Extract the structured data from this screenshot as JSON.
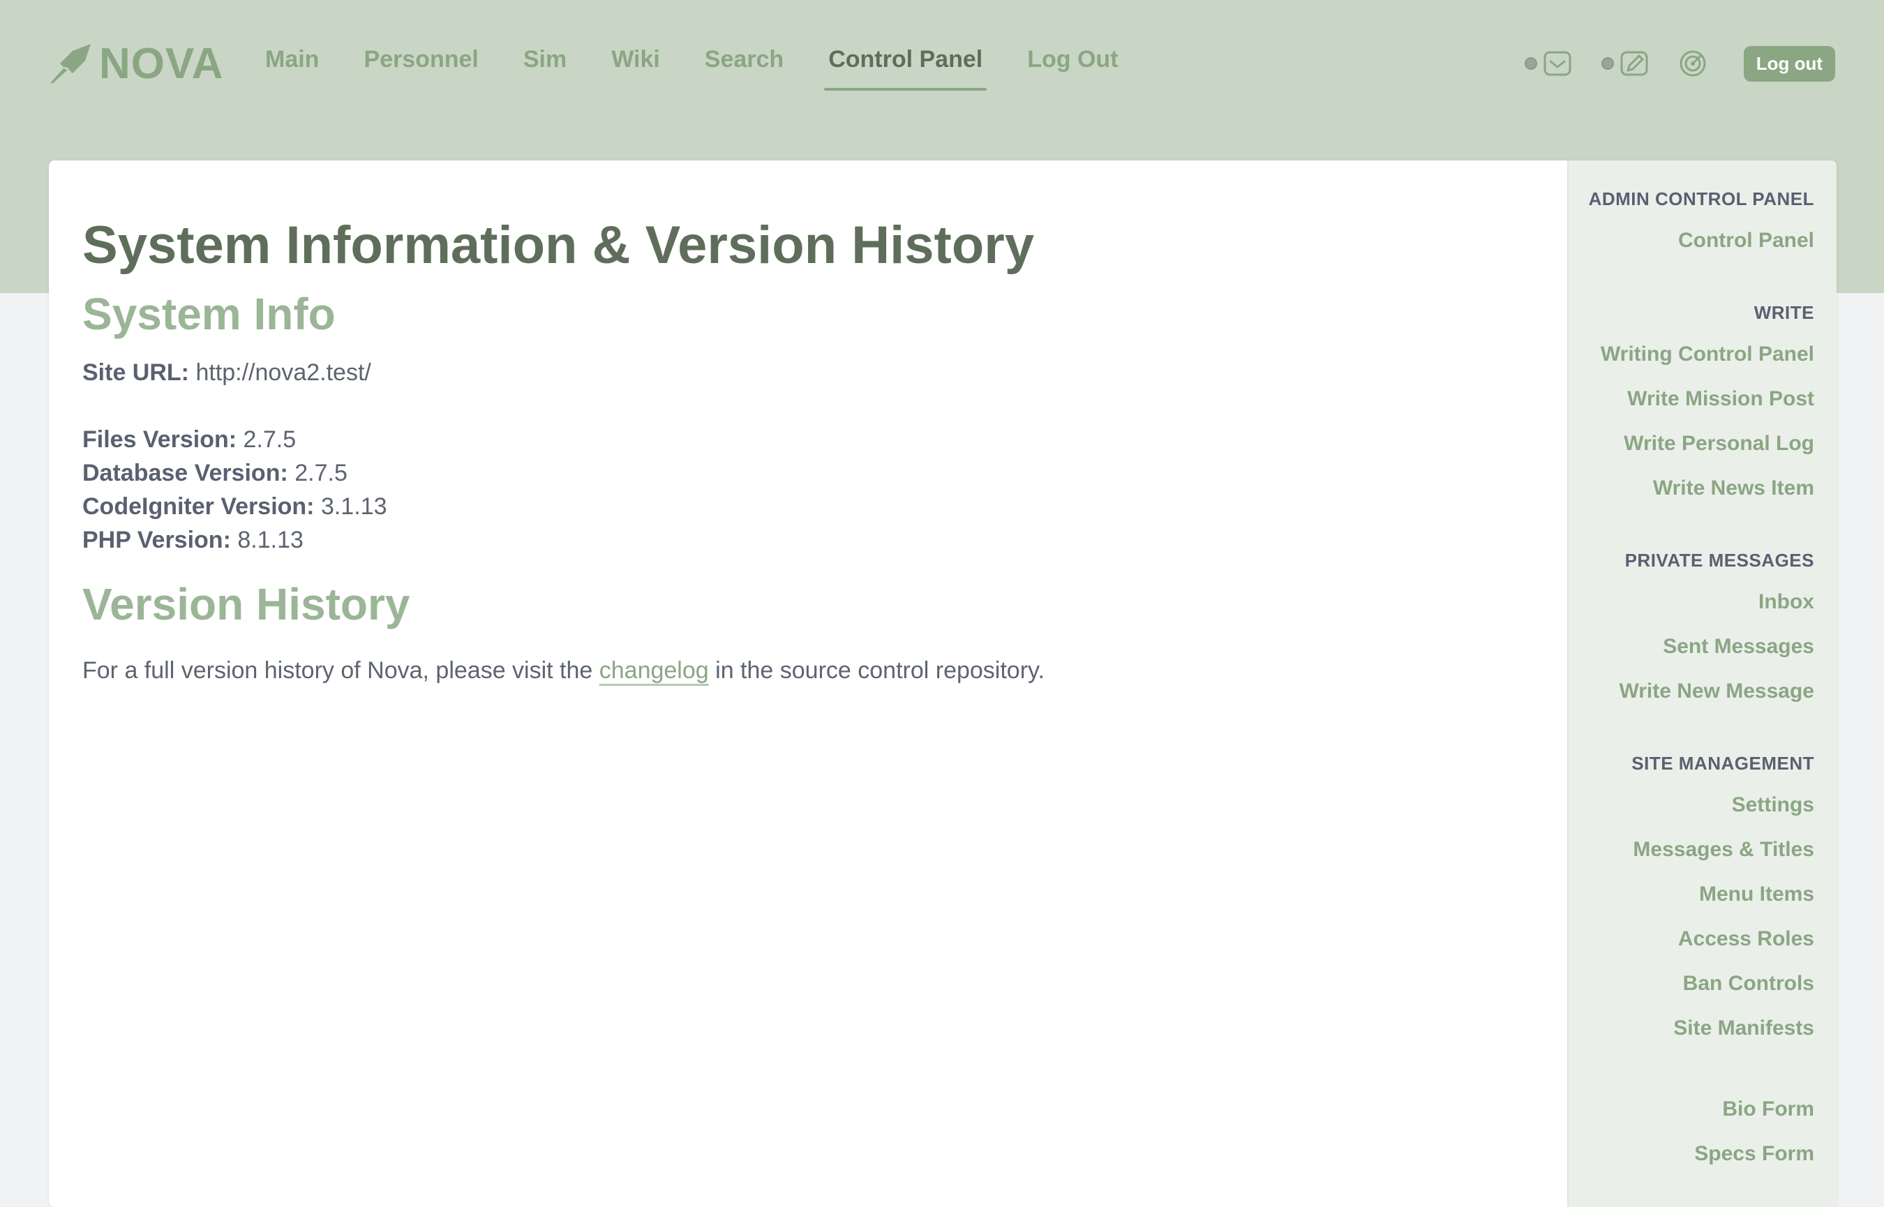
{
  "brand": {
    "name": "NOVA"
  },
  "nav": {
    "items": [
      {
        "label": "Main",
        "active": false
      },
      {
        "label": "Personnel",
        "active": false
      },
      {
        "label": "Sim",
        "active": false
      },
      {
        "label": "Wiki",
        "active": false
      },
      {
        "label": "Search",
        "active": false
      },
      {
        "label": "Control Panel",
        "active": true
      },
      {
        "label": "Log Out",
        "active": false
      }
    ]
  },
  "toolbar": {
    "icons": [
      "inbox-icon",
      "write-icon",
      "radar-icon"
    ],
    "logout_label": "Log out"
  },
  "page": {
    "title": "System Information & Version History",
    "system_info": {
      "heading": "System Info",
      "site_url_label": "Site URL:",
      "site_url_value": "http://nova2.test/",
      "files_label": "Files Version:",
      "files_value": "2.7.5",
      "database_label": "Database Version:",
      "database_value": "2.7.5",
      "codeigniter_label": "CodeIgniter Version:",
      "codeigniter_value": "3.1.13",
      "php_label": "PHP Version:",
      "php_value": "8.1.13"
    },
    "version_history": {
      "heading": "Version History",
      "text_before": "For a full version history of Nova, please visit the ",
      "link_label": "changelog",
      "text_after": " in the source control repository."
    }
  },
  "sidebar": {
    "groups": [
      {
        "heading": "ADMIN CONTROL PANEL",
        "links": [
          "Control Panel"
        ]
      },
      {
        "heading": "WRITE",
        "links": [
          "Writing Control Panel",
          "Write Mission Post",
          "Write Personal Log",
          "Write News Item"
        ]
      },
      {
        "heading": "PRIVATE MESSAGES",
        "links": [
          "Inbox",
          "Sent Messages",
          "Write New Message"
        ]
      },
      {
        "heading": "SITE MANAGEMENT",
        "links": [
          "Settings",
          "Messages & Titles",
          "Menu Items",
          "Access Roles",
          "Ban Controls",
          "Site Manifests"
        ]
      }
    ],
    "extra_links": [
      "Bio Form",
      "Specs Form"
    ]
  },
  "colors": {
    "header_bg": "#c9d6c5",
    "accent": "#8aa683",
    "active_nav": "#5f6e5b",
    "sidebar_bg": "#ebefea"
  }
}
